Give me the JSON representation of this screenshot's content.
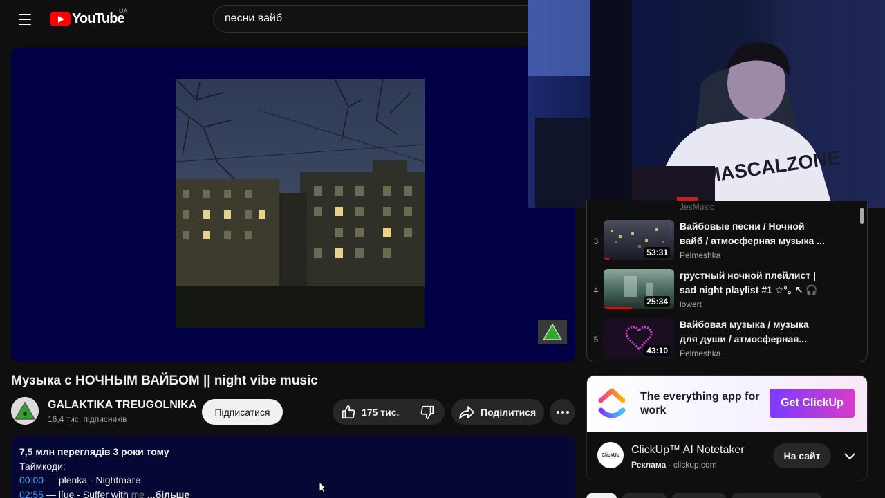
{
  "header": {
    "logo_text": "YouTube",
    "country_code": "UA",
    "search_query": "песни вайб"
  },
  "video": {
    "title": "Музыка с НОЧНЫМ ВАЙБОМ || night vibe music",
    "channel_name": "GALAKTIKA TREUGOLNIKA",
    "subscribers": "16,4 тис. підписників",
    "subscribe_label": "Підписатися",
    "likes": "175 тис.",
    "share_label": "Поділитися"
  },
  "description": {
    "meta": "7,5 млн переглядів  3 роки тому",
    "heading": "Таймкоди:",
    "lines": [
      {
        "time": "00:00",
        "text": " — plenka - Nightmare"
      },
      {
        "time": "02:55",
        "text": " — líue - Suffer with ",
        "faded": "me",
        "more": " ...більше"
      }
    ]
  },
  "playlist": {
    "partial_channel": "JesMusic",
    "items": [
      {
        "index": "3",
        "title": "Вайбовые песни / Ночной вайб / атмосферная музыка ...",
        "channel": "Pelmeshka",
        "duration": "53:31",
        "progress": 0.08
      },
      {
        "index": "4",
        "title": "грустный ночной плейлист | sad night playlist #1 ☆°｡ ↖ 🎧",
        "channel": "lowert",
        "duration": "25:34",
        "progress": 0.4
      },
      {
        "index": "5",
        "title": "Вайбовая музыка / музыка для души / атмосферная...",
        "channel": "Pelmeshka",
        "duration": "43:10",
        "progress": 0
      }
    ]
  },
  "ad": {
    "headline": "The everything app for work",
    "cta": "Get ClickUp",
    "title": "ClickUp™ AI Notetaker",
    "sponsored_label": "Реклама",
    "domain": "clickup.com",
    "site_button": "На сайт",
    "avatar_text": "ClickUp"
  },
  "colors": {
    "accent_red": "#ff0000",
    "link_blue": "#3ea6ff",
    "player_bg": "#020044",
    "ad_cta_gradient_start": "#7b3cff"
  }
}
